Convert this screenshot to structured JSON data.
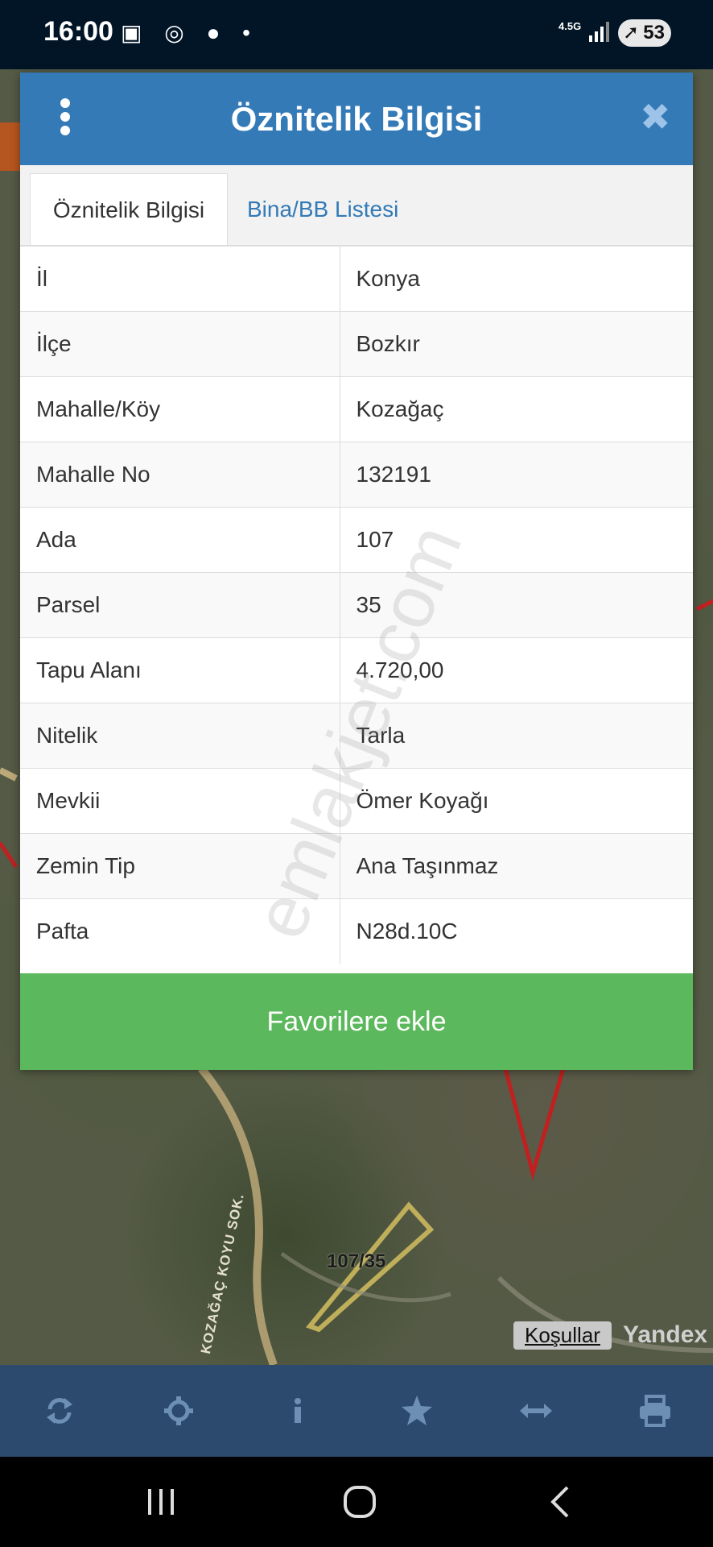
{
  "status_bar": {
    "time": "16:00",
    "network": "4.5G",
    "battery": "53"
  },
  "modal": {
    "title": "Öznitelik Bilgisi",
    "tabs": [
      {
        "label": "Öznitelik Bilgisi",
        "active": true
      },
      {
        "label": "Bina/BB Listesi",
        "active": false
      }
    ],
    "rows": [
      {
        "key": "İl",
        "value": "Konya"
      },
      {
        "key": "İlçe",
        "value": "Bozkır"
      },
      {
        "key": "Mahalle/Köy",
        "value": "Kozağaç"
      },
      {
        "key": "Mahalle No",
        "value": "132191"
      },
      {
        "key": "Ada",
        "value": "107"
      },
      {
        "key": "Parsel",
        "value": "35"
      },
      {
        "key": "Tapu Alanı",
        "value": "4.720,00"
      },
      {
        "key": "Nitelik",
        "value": "Tarla"
      },
      {
        "key": "Mevkii",
        "value": "Ömer Koyağı"
      },
      {
        "key": "Zemin Tip",
        "value": "Ana Taşınmaz"
      },
      {
        "key": "Pafta",
        "value": "N28d.10C"
      }
    ],
    "favorite_label": "Favorilere ekle",
    "watermark": "emlakjet.com"
  },
  "map": {
    "parcel_label": "107/35",
    "road_label": "KOZAĞAÇ KOYU SOK.",
    "terms_label": "Koşullar",
    "provider": "Yandex"
  },
  "toolbar": {
    "tools": [
      "refresh-icon",
      "locate-icon",
      "info-icon",
      "star-icon",
      "measure-icon",
      "print-icon"
    ]
  },
  "colors": {
    "header": "#337ab7",
    "favorite": "#5cb85c",
    "toolbar": "#2b4a6e"
  }
}
